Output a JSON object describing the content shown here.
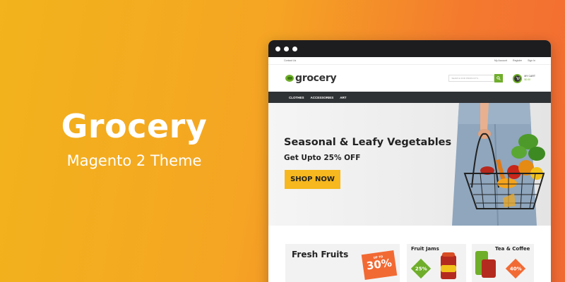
{
  "promo": {
    "title": "Grocery",
    "subtitle": "Magento 2 Theme"
  },
  "topbar": {
    "contact": "Contact Us",
    "links": [
      "My Account",
      "Register",
      "Sign In"
    ]
  },
  "header": {
    "logo": "grocery",
    "search_placeholder": "SEARCH FOR PRODUCTS...",
    "cart_label": "MY CART",
    "cart_price": "$0.00"
  },
  "nav": {
    "items": [
      "CLOTHES",
      "ACCESSORIES",
      "ART"
    ]
  },
  "hero": {
    "title": "Seasonal & Leafy Vegetables",
    "subtitle": "Get Upto 25% OFF",
    "button": "SHOP NOW"
  },
  "cards": {
    "fruits": {
      "title": "Fresh Fruits",
      "badge_top": "UP TO",
      "badge_value": "30%"
    },
    "jams": {
      "title": "Fruit Jams",
      "badge": "25%"
    },
    "tea": {
      "title": "Tea & Coffee",
      "badge": "40%"
    }
  },
  "colors": {
    "accent_green": "#6fae2a",
    "accent_orange": "#f26a33",
    "button_yellow": "#f6b81e",
    "nav_dark": "#2f3235"
  }
}
